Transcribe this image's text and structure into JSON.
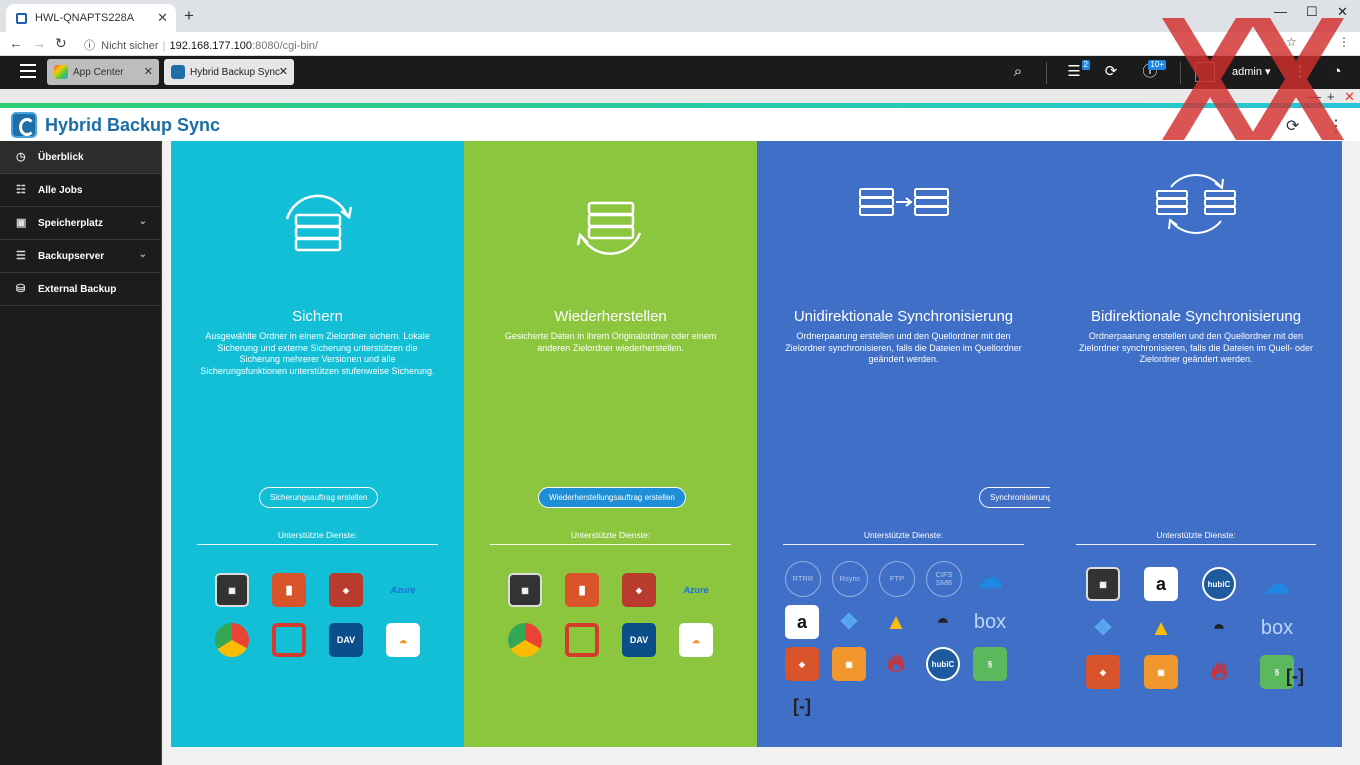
{
  "browser": {
    "tab_title": "HWL-QNAPTS228A",
    "new_tab": "+",
    "not_secure": "Nicht sicher",
    "host": "192.168.177.100",
    "path": ":8080/cgi-bin/"
  },
  "qts": {
    "tabs": [
      {
        "label": "App Center",
        "active": false
      },
      {
        "label": "Hybrid Backup Sync",
        "active": true
      }
    ],
    "badges": {
      "tasks": "2",
      "notifications": "10+"
    },
    "user": "admin ▾"
  },
  "app": {
    "title": "Hybrid Backup Sync"
  },
  "sidebar": {
    "items": [
      {
        "label": "Überblick",
        "active": true,
        "chevron": false
      },
      {
        "label": "Alle Jobs",
        "active": false,
        "chevron": false
      },
      {
        "label": "Speicherplatz",
        "active": false,
        "chevron": true
      },
      {
        "label": "Backupserver",
        "active": false,
        "chevron": true
      },
      {
        "label": "External Backup",
        "active": false,
        "chevron": false
      }
    ]
  },
  "panels": [
    {
      "title": "Sichern",
      "color": "#12bfd6",
      "desc": "Ausgewählte Ordner in einem Zielordner sichern. Lokale Sicherung und externe Sicherung unterstützen die Sicherung mehrerer Versionen und alle Sicherungsfunktionen unterstützen stufenweise Sicherung.",
      "button": "Sicherungsauftrag erstellen",
      "services_label": "Unterstützte Dienste:"
    },
    {
      "title": "Wiederherstellen",
      "color": "#8cc63f",
      "desc": "Gesicherte Daten in ihrem Originalordner oder einem anderen Zielordner wiederherstellen.",
      "button": "Wiederherstellungsauftrag erstellen",
      "services_label": "Unterstützte Dienste:"
    },
    {
      "title": "Unidirektionale Synchronisierung",
      "color": "#3f6fc6",
      "desc": "Ordnerpaarung erstellen und den Quellordner mit den Zielordner synchronisieren, falls die Dateien im Quellordner geändert werden.",
      "button": "Synchronisierungsauftrag erstellen",
      "services_label": "Unterstützte Dienste:",
      "circles": [
        "RTRR",
        "Rsync",
        "FTP",
        "CIFS\nSMB"
      ]
    },
    {
      "title": "Bidirektionale Synchronisierung",
      "color": "#3f6fc6",
      "desc": "Ordnerpaarung erstellen und den Quellordner mit den Zielordner synchronisieren, falls die Dateien im Quell- oder Zielordner geändert werden.",
      "services_label": "Unterstützte Dienste:"
    }
  ],
  "service_text": {
    "azure": "Azure",
    "dav": "DAV",
    "hubic": "hubiC",
    "box": "box"
  }
}
